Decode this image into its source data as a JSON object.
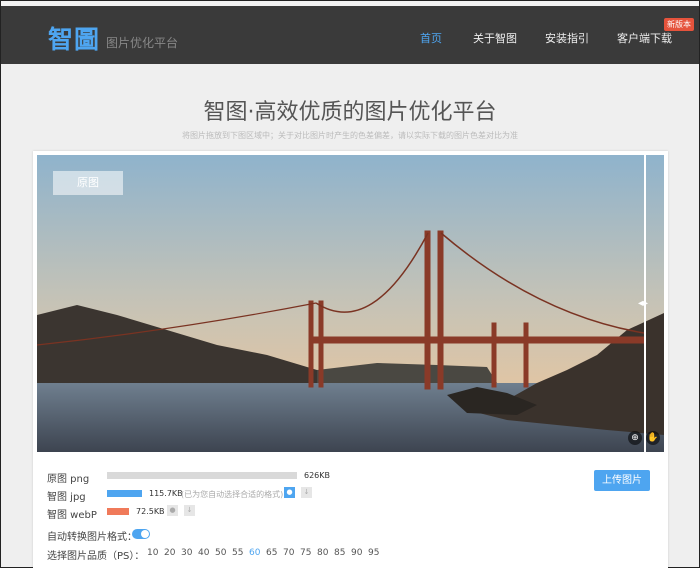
{
  "header": {
    "logo_text": "智圖",
    "logo_sub": "图片优化平台",
    "nav": [
      "首页",
      "关于智图",
      "安装指引",
      "客户端下载"
    ],
    "badge": "新版本"
  },
  "hero": {
    "title": "智图·高效优质的图片优化平台",
    "subtitle": "将图片拖放到下图区域中；关于对比图片时产生的色差偏差，请以实际下载的图片色差对比为准"
  },
  "preview": {
    "original_tab": "原图",
    "zoom_icon": "zoom-in-icon",
    "hand_icon": "hand-icon"
  },
  "results": {
    "rows": [
      {
        "label": "原图 png",
        "size": "626KB",
        "color": "#d9d9d9",
        "ratio": 1.0
      },
      {
        "label": "智图 jpg",
        "size": "115.7KB",
        "hint": "(已为您自动选择合适的格式)",
        "color": "#4ea5f0",
        "ratio": 0.185
      },
      {
        "label": "智图 webP",
        "size": "72.5KB",
        "color": "#f07a5a",
        "ratio": 0.116
      }
    ],
    "upload_label": "上传图片",
    "auto_convert_label": "自动转换图片格式：",
    "quality_label": "选择图片品质（PS）：",
    "quality_options": [
      "10",
      "20",
      "30",
      "40",
      "50",
      "55",
      "60",
      "65",
      "70",
      "75",
      "80",
      "85",
      "90",
      "95"
    ],
    "quality_selected": "60"
  },
  "colors": {
    "accent": "#4ea5f0",
    "header_bg": "#3a3a3a"
  }
}
